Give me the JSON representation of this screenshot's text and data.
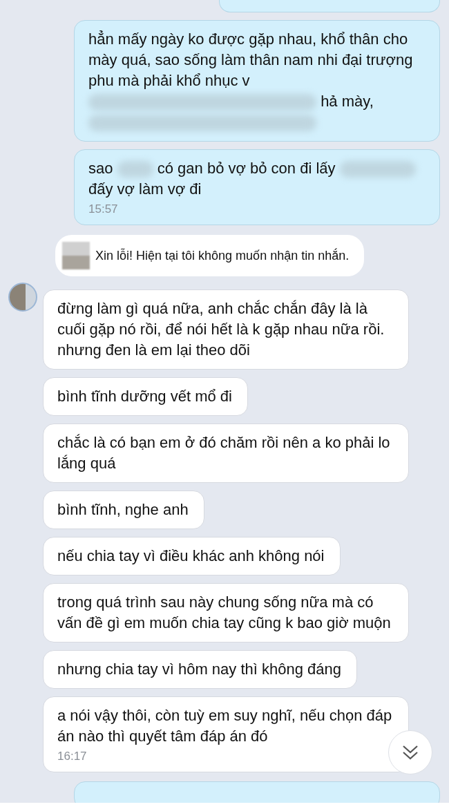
{
  "messages": [
    {
      "kind": "sent_cut"
    },
    {
      "kind": "sent",
      "segments": [
        {
          "kind": "text",
          "text": "hẳn mấy ngày ko được gặp nhau, khổ thân cho mày quá, sao sống làm thân nam nhi đại trượng phu mà phải khổ nhục v"
        },
        {
          "kind": "blur_long"
        },
        {
          "kind": "text",
          "text": "hả mày,"
        },
        {
          "kind": "blur_long"
        }
      ]
    },
    {
      "kind": "sent",
      "segments": [
        {
          "kind": "text",
          "text": "sao"
        },
        {
          "kind": "blur_short"
        },
        {
          "kind": "text",
          "text": "có gan bỏ vợ bỏ con đi lấy"
        },
        {
          "kind": "blur_medium"
        },
        {
          "kind": "text",
          "text": "đấy vợ làm vợ đi"
        }
      ],
      "time": "15:57"
    },
    {
      "kind": "notice",
      "segments": [
        {
          "kind": "text",
          "text": "Xin lỗi! Hiện tại tôi không muốn nhận tin nhắn."
        }
      ]
    },
    {
      "kind": "received",
      "avatar": true,
      "segments": [
        {
          "kind": "text",
          "text": "đừng làm gì quá nữa, anh chắc chắn đây là là cuối gặp nó rồi, để nói hết là k gặp nhau nữa rồi. nhưng đen là em lại theo dõi"
        }
      ]
    },
    {
      "kind": "received",
      "segments": [
        {
          "kind": "text",
          "text": "bình tĩnh dưỡng vết mổ đi"
        }
      ]
    },
    {
      "kind": "received",
      "segments": [
        {
          "kind": "text",
          "text": "chắc là có bạn em ở đó chăm rồi nên a ko phải lo lắng quá"
        }
      ]
    },
    {
      "kind": "received",
      "segments": [
        {
          "kind": "text",
          "text": "bình tĩnh, nghe anh"
        }
      ]
    },
    {
      "kind": "received",
      "segments": [
        {
          "kind": "text",
          "text": "nếu chia tay vì điều khác anh không nói"
        }
      ]
    },
    {
      "kind": "received",
      "segments": [
        {
          "kind": "text",
          "text": "trong quá trình sau này chung sống nữa mà có vấn đề gì em muốn chia tay cũng k bao giờ muộn"
        }
      ]
    },
    {
      "kind": "received",
      "segments": [
        {
          "kind": "text",
          "text": "nhưng chia tay vì hôm nay thì không đáng"
        }
      ]
    },
    {
      "kind": "received",
      "segments": [
        {
          "kind": "text",
          "text": "a nói vậy thôi, còn tuỳ em suy nghĩ, nếu chọn đáp án nào thì quyết tâm đáp án đó"
        }
      ],
      "time": "16:17"
    },
    {
      "kind": "sent_cut"
    }
  ]
}
